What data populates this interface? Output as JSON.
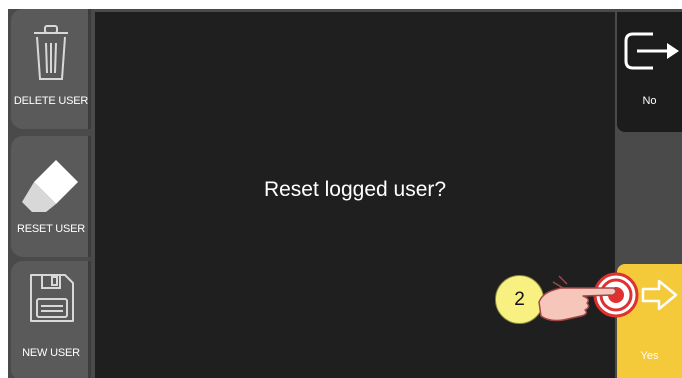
{
  "dialog": {
    "prompt": "Reset logged user?"
  },
  "left_toolbar": {
    "delete_user": {
      "label": "DELETE USER",
      "icon": "trash-icon"
    },
    "reset_user": {
      "label": "RESET USER",
      "icon": "eraser-icon"
    },
    "new_user": {
      "label": "NEW USER",
      "icon": "floppy-disk-icon"
    }
  },
  "right_toolbar": {
    "no": {
      "label": "No",
      "icon": "exit-arrow-icon"
    },
    "yes": {
      "label": "Yes",
      "icon": "arrow-right-icon"
    }
  },
  "tutorial": {
    "step_number": "2",
    "icon": "tap-hand-icon"
  },
  "colors": {
    "accent_yes": "#f4c93a",
    "dialog_bg": "#1f1f1f",
    "panel_bg": "#4a4a4a"
  }
}
